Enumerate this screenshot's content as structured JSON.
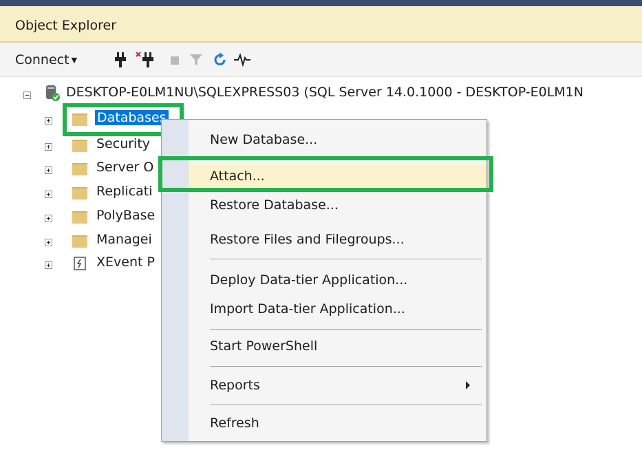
{
  "panel": {
    "title": "Object Explorer"
  },
  "toolbar": {
    "connect_label": "Connect",
    "icons": [
      "connect-plug-icon",
      "disconnect-plug-icon",
      "stop-icon",
      "filter-icon",
      "refresh-icon",
      "activity-monitor-icon"
    ]
  },
  "tree": {
    "server_label": "DESKTOP-E0LM1NU\\SQLEXPRESS03 (SQL Server 14.0.1000 - DESKTOP-E0LM1N",
    "nodes": [
      {
        "label": "Databases",
        "selected": true
      },
      {
        "label": "Security"
      },
      {
        "label": "Server O"
      },
      {
        "label": "Replicati"
      },
      {
        "label": "PolyBase"
      },
      {
        "label": "Managei"
      },
      {
        "label": "XEvent P"
      }
    ]
  },
  "context_menu": {
    "items": [
      {
        "label": "New Database..."
      },
      {
        "label": "Attach...",
        "highlighted": true
      },
      {
        "label": "Restore Database..."
      },
      {
        "label": "Restore Files and Filegroups..."
      },
      {
        "label": "Deploy Data-tier Application..."
      },
      {
        "label": "Import Data-tier Application..."
      },
      {
        "label": "Start PowerShell"
      },
      {
        "label": "Reports",
        "has_submenu": true
      },
      {
        "label": "Refresh"
      }
    ]
  },
  "colors": {
    "highlight_box": "#22b14c",
    "selection": "#0078d7",
    "title_bar": "#f7efc7",
    "menu_hover": "#fcf3cc"
  }
}
